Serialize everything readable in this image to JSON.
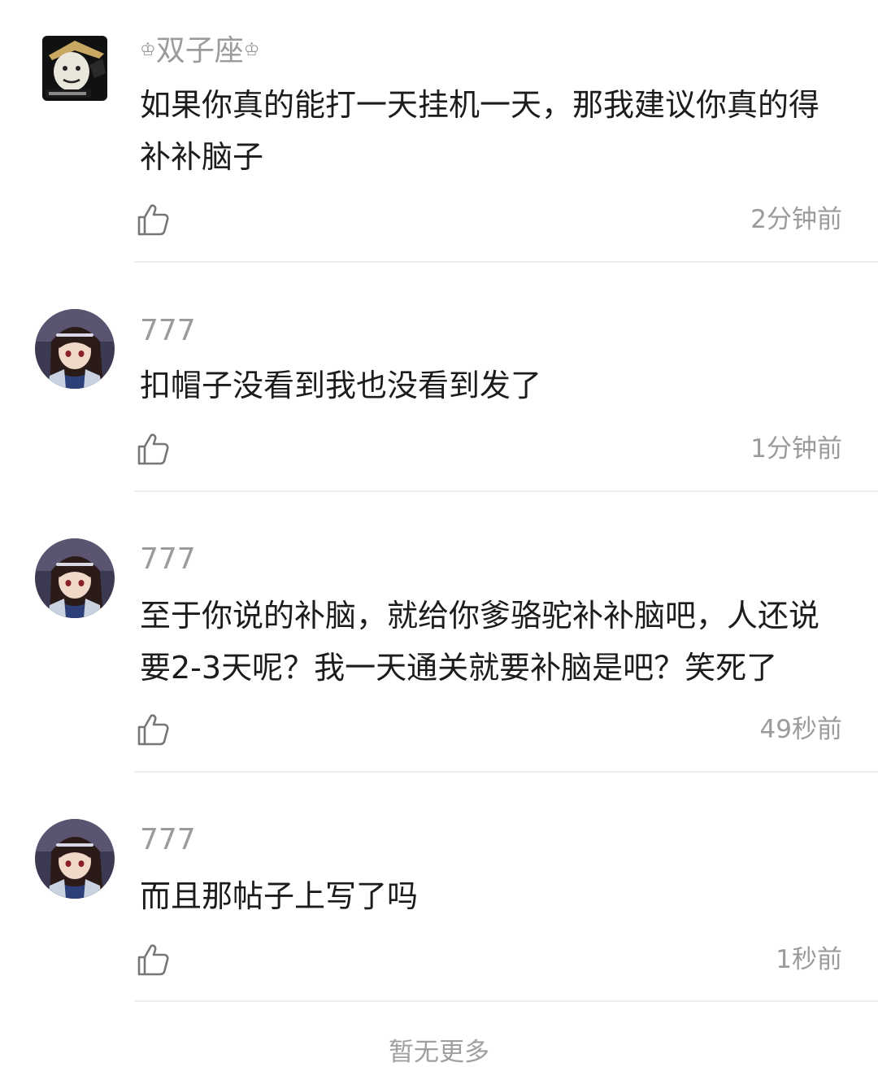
{
  "comments": [
    {
      "username": "双子座",
      "username_decoration": "♔",
      "avatar": "meme-face-avatar",
      "text": "如果你真的能打一天挂机一天，那我建议你真的得补补脑子",
      "like_icon": "thumbs-up-icon",
      "time": "2分钟前"
    },
    {
      "username": "777",
      "avatar": "anime-girl-avatar",
      "text": "扣帽子没看到我也没看到发了",
      "like_icon": "thumbs-up-icon",
      "time": "1分钟前"
    },
    {
      "username": "777",
      "avatar": "anime-girl-avatar",
      "text": "至于你说的补脑，就给你爹骆驼补补脑吧，人还说要2-3天呢？我一天通关就要补脑是吧？笑死了",
      "like_icon": "thumbs-up-icon",
      "time": "49秒前"
    },
    {
      "username": "777",
      "avatar": "anime-girl-avatar",
      "text": "而且那帖子上写了吗",
      "like_icon": "thumbs-up-icon",
      "time": "1秒前"
    }
  ],
  "footer": {
    "text": "暂无更多"
  },
  "colors": {
    "username": "#9b9b9b",
    "text": "#1c1c1c",
    "divider": "#ededed",
    "meta": "#9b9b9b"
  }
}
